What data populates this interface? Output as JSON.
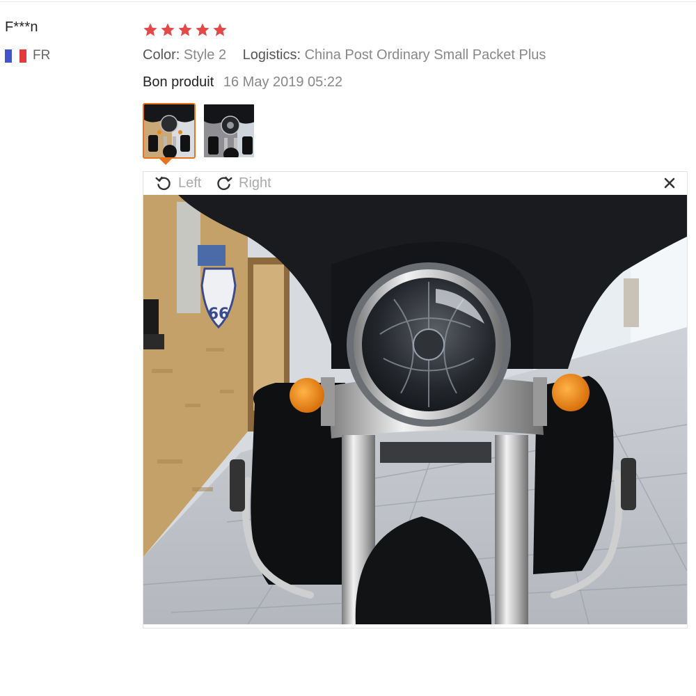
{
  "user": {
    "name": "F***n",
    "country_code": "FR",
    "flag_icon": "france-flag-icon"
  },
  "review": {
    "rating": 5,
    "rating_max": 5,
    "star_color": "#e24a4a",
    "color_label": "Color:",
    "color_value": "Style 2",
    "logistics_label": "Logistics:",
    "logistics_value": "China Post Ordinary Small Packet Plus",
    "feedback": "Bon produit",
    "date": "16 May 2019 05:22"
  },
  "thumbnails": [
    {
      "name": "review-photo-thumb-1",
      "active": true
    },
    {
      "name": "review-photo-thumb-2",
      "active": false
    }
  ],
  "viewer": {
    "rotate_left_label": "Left",
    "rotate_right_label": "Right",
    "rotate_left_icon": "rotate-left-icon",
    "rotate_right_icon": "rotate-right-icon",
    "close_icon": "close-icon",
    "accent_color": "#e6731e"
  }
}
